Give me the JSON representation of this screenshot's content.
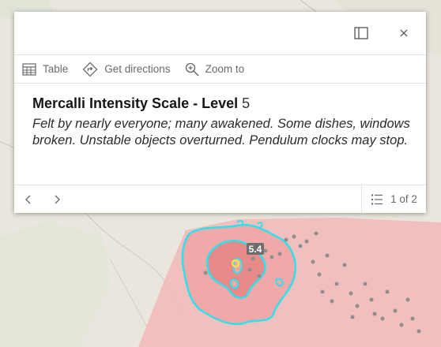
{
  "header": {
    "dock_icon": "dock-panel-icon",
    "close_icon": "close-icon"
  },
  "actions": [
    {
      "label": "Table",
      "icon": "table-icon"
    },
    {
      "label": "Get directions",
      "icon": "directions-icon"
    },
    {
      "label": "Zoom to",
      "icon": "zoom-to-icon"
    }
  ],
  "feature": {
    "title": "Mercalli Intensity Scale -  Level",
    "level": "5",
    "description": "Felt by nearly everyone; many awakened. Some dishes, windows broken. Unstable objects overturned. Pendulum clocks may stop."
  },
  "pager": {
    "count_text": "1 of 2"
  },
  "map": {
    "magnitude_label": "5.4",
    "colors": {
      "base": "#ebe6dd",
      "intensity_fill": "#f2b9b9",
      "intensity_core": "#e98a8a",
      "contour": "#2de0ee",
      "epicenter": "#f5e04b",
      "quake_point": "#8e8e8e"
    }
  }
}
